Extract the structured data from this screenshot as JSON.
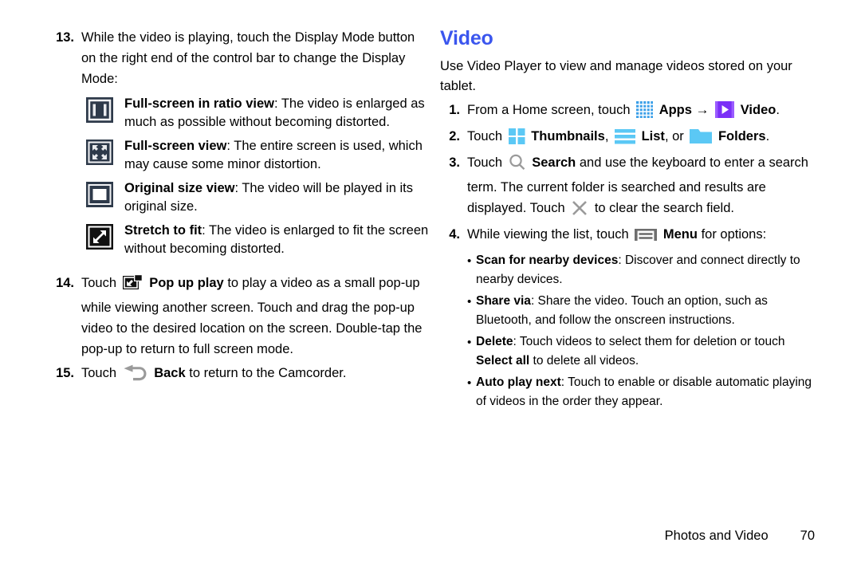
{
  "left_column": {
    "steps": [
      {
        "number": "13.",
        "text": "While the video is playing, touch the Display Mode button on the right end of the control bar to change the Display Mode:"
      }
    ],
    "display_modes": [
      {
        "icon": "full-screen-in-ratio-view-icon",
        "label": "Full-screen in ratio view",
        "desc": ": The video is enlarged as much as possible without becoming distorted."
      },
      {
        "icon": "full-screen-view-icon",
        "label": "Full-screen view",
        "desc": ": The entire screen is used, which may cause some minor distortion."
      },
      {
        "icon": "original-size-view-icon",
        "label": "Original size view",
        "desc": ": The video will be played in its original size."
      },
      {
        "icon": "stretch-to-fit-icon",
        "label": "Stretch to fit",
        "desc": ": The video is enlarged to fit the screen without becoming distorted."
      }
    ],
    "step14": {
      "number": "14.",
      "prefix": "Touch",
      "icon": "pop-up-play-icon",
      "bold_label": "Pop up play",
      "text": "to play a video as a small pop-up while viewing another screen. Touch and drag the pop-up video to the desired location on the screen. Double-tap the pop-up to return to full screen mode."
    },
    "step15": {
      "number": "15.",
      "prefix": "Touch",
      "icon": "back-icon",
      "bold_label": "Back",
      "text": "to return to the Camcorder."
    }
  },
  "right_column": {
    "title": "Video",
    "intro": "Use Video Player to view and manage videos stored on your tablet.",
    "step1": {
      "number": "1.",
      "prefix": "From a Home screen, touch",
      "apps_icon": "apps-grid-icon",
      "apps_label": "Apps",
      "arrow": "→",
      "video_icon": "video-player-icon",
      "video_label": "Video",
      "suffix": "."
    },
    "step2": {
      "number": "2.",
      "prefix": "Touch",
      "thumbnails_icon": "thumbnails-icon",
      "thumbnails_label": "Thumbnails",
      "sep1": ",",
      "list_icon": "list-icon",
      "list_label": "List",
      "sep2": ", or",
      "folders_icon": "folders-icon",
      "folders_label": "Folders",
      "suffix": "."
    },
    "step3": {
      "number": "3.",
      "prefix": "Touch",
      "search_icon": "search-icon",
      "search_label": "Search",
      "text_a": "and use the keyboard to enter a search term. The current folder is searched and results are displayed. Touch",
      "clear_icon": "clear-x-icon",
      "text_b": "to clear the search field."
    },
    "step4": {
      "number": "4.",
      "prefix": "While viewing the list, touch",
      "menu_icon": "menu-icon",
      "menu_label": "Menu",
      "suffix": "for options:"
    },
    "options": [
      {
        "label": "Scan for nearby devices",
        "desc": ": Discover and connect directly to nearby devices."
      },
      {
        "label": "Share via",
        "desc": ": Share the video. Touch an option, such as Bluetooth, and follow the onscreen instructions."
      },
      {
        "label": "Delete",
        "desc": ": Touch videos to select them for deletion or touch ",
        "label2": "Select all",
        "desc2": " to delete all videos."
      },
      {
        "label": "Auto play next",
        "desc": ": Touch to enable or disable automatic playing of videos in the order they appear."
      }
    ]
  },
  "footer": {
    "label": "Photos and Video",
    "page_number": "70"
  },
  "colors": {
    "heading_blue": "#3b56ee",
    "icon_slate": "#2e3a4a",
    "icon_light_blue": "#5bc8f5",
    "icon_apps_blue": "#3a9fe8",
    "icon_video_purple": "#7b2ff7",
    "icon_gray": "#9a9a9a"
  }
}
